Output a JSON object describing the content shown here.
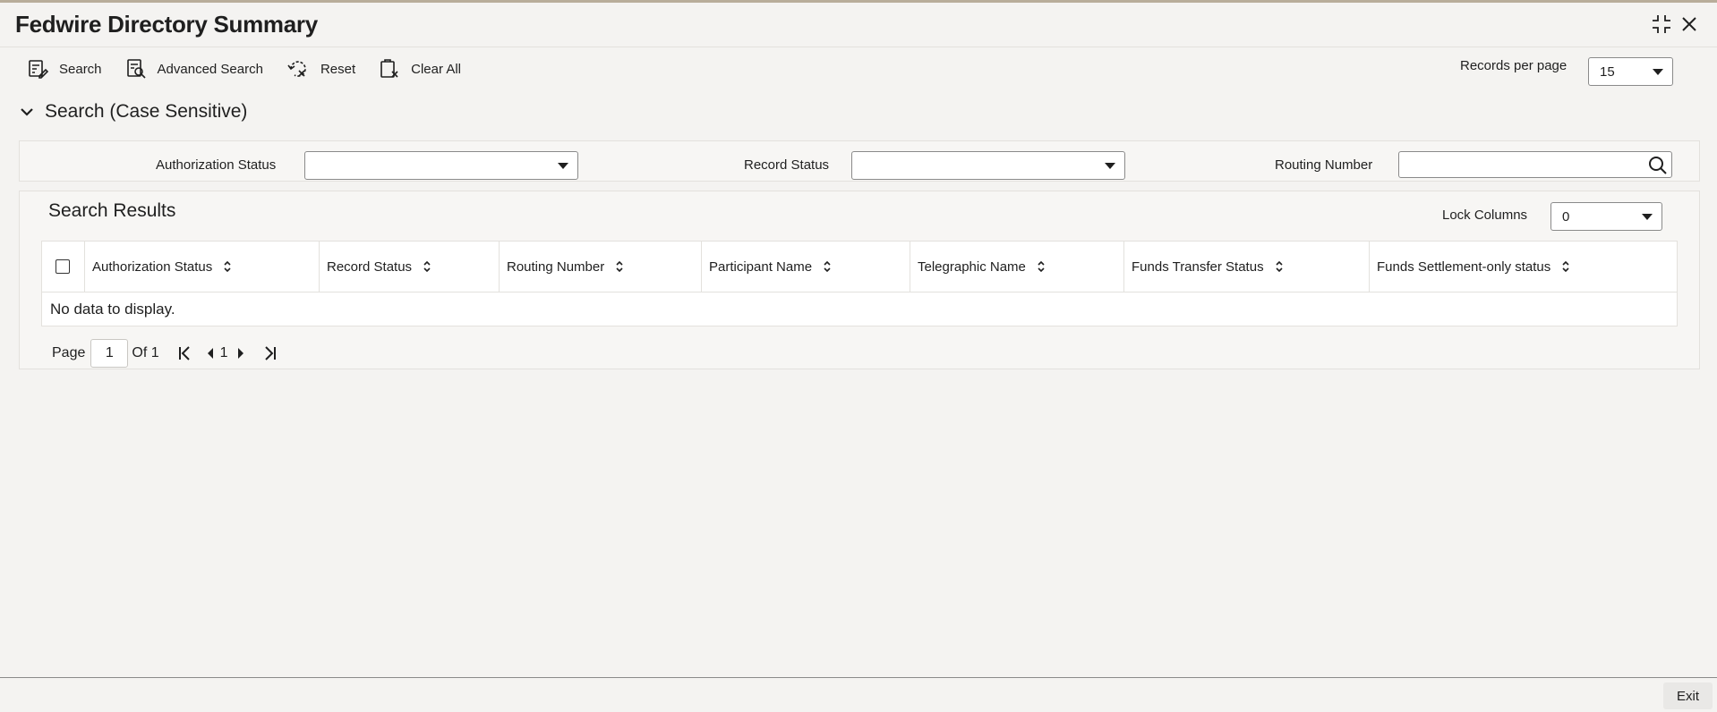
{
  "window": {
    "title": "Fedwire Directory Summary"
  },
  "toolbar": {
    "search_label": "Search",
    "advanced_search_label": "Advanced Search",
    "reset_label": "Reset",
    "clear_all_label": "Clear All"
  },
  "records_per_page": {
    "label": "Records per page",
    "value": "15"
  },
  "search_section": {
    "title": "Search (Case Sensitive)",
    "authorization_status_label": "Authorization Status",
    "authorization_status_value": "",
    "record_status_label": "Record Status",
    "record_status_value": "",
    "routing_number_label": "Routing Number",
    "routing_number_value": ""
  },
  "results": {
    "title": "Search Results",
    "lock_columns_label": "Lock Columns",
    "lock_columns_value": "0",
    "columns": [
      "Authorization Status",
      "Record Status",
      "Routing Number",
      "Participant Name",
      "Telegraphic Name",
      "Funds Transfer Status",
      "Funds Settlement-only status"
    ],
    "empty_message": "No data to display."
  },
  "pagination": {
    "page_label": "Page",
    "current_page": "1",
    "of_label": "Of 1",
    "page_number_link": "1"
  },
  "footer": {
    "exit_label": "Exit"
  },
  "icons": {
    "search": "search-form-icon",
    "advanced_search": "advanced-search-icon",
    "reset": "reset-icon",
    "clear_all": "clear-all-icon",
    "magnifier": "magnifier-icon",
    "minimize": "minimize-icon",
    "close": "close-icon"
  }
}
